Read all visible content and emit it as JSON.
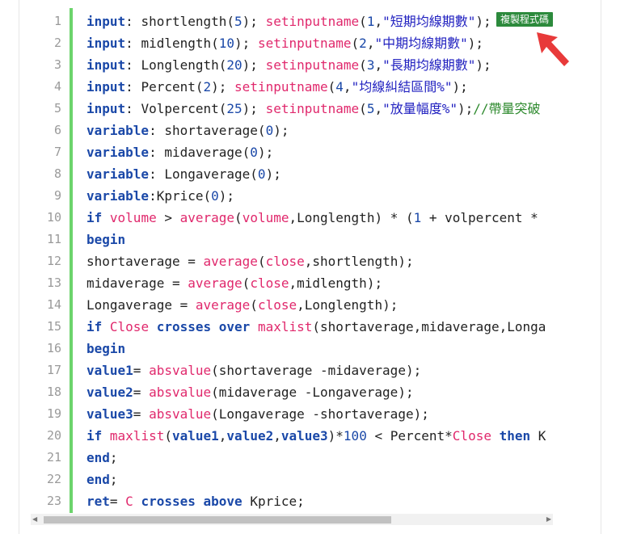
{
  "copy_button_label": "複製程式碼",
  "colors": {
    "keyword": "#1a48a8",
    "function": "#e0286c",
    "string": "#2121c0",
    "comment": "#2e8a2e",
    "accent_bar": "#6cd46c",
    "copy_button_bg": "#2c8a3c",
    "arrow": "#e83a3a"
  },
  "icons": {
    "arrow": "red-pointer-arrow-icon",
    "scroll_left": "scroll-left-arrow-icon",
    "scroll_right": "scroll-right-arrow-icon"
  },
  "line_numbers": [
    "1",
    "2",
    "3",
    "4",
    "5",
    "6",
    "7",
    "8",
    "9",
    "10",
    "11",
    "12",
    "13",
    "14",
    "15",
    "16",
    "17",
    "18",
    "19",
    "20",
    "21",
    "22",
    "23"
  ],
  "code": [
    [
      {
        "t": "input",
        "c": "kw"
      },
      {
        "t": ": shortlength(",
        "c": "plain"
      },
      {
        "t": "5",
        "c": "num"
      },
      {
        "t": "); ",
        "c": "plain"
      },
      {
        "t": "setinputname",
        "c": "fn"
      },
      {
        "t": "(",
        "c": "plain"
      },
      {
        "t": "1",
        "c": "num"
      },
      {
        "t": ",",
        "c": "plain"
      },
      {
        "t": "\"短期均線期數\"",
        "c": "str"
      },
      {
        "t": ");",
        "c": "plain"
      }
    ],
    [
      {
        "t": "input",
        "c": "kw"
      },
      {
        "t": ": midlength(",
        "c": "plain"
      },
      {
        "t": "10",
        "c": "num"
      },
      {
        "t": "); ",
        "c": "plain"
      },
      {
        "t": "setinputname",
        "c": "fn"
      },
      {
        "t": "(",
        "c": "plain"
      },
      {
        "t": "2",
        "c": "num"
      },
      {
        "t": ",",
        "c": "plain"
      },
      {
        "t": "\"中期均線期數\"",
        "c": "str"
      },
      {
        "t": ");",
        "c": "plain"
      }
    ],
    [
      {
        "t": "input",
        "c": "kw"
      },
      {
        "t": ": Longlength(",
        "c": "plain"
      },
      {
        "t": "20",
        "c": "num"
      },
      {
        "t": "); ",
        "c": "plain"
      },
      {
        "t": "setinputname",
        "c": "fn"
      },
      {
        "t": "(",
        "c": "plain"
      },
      {
        "t": "3",
        "c": "num"
      },
      {
        "t": ",",
        "c": "plain"
      },
      {
        "t": "\"長期均線期數\"",
        "c": "str"
      },
      {
        "t": ");",
        "c": "plain"
      }
    ],
    [
      {
        "t": "input",
        "c": "kw"
      },
      {
        "t": ": Percent(",
        "c": "plain"
      },
      {
        "t": "2",
        "c": "num"
      },
      {
        "t": "); ",
        "c": "plain"
      },
      {
        "t": "setinputname",
        "c": "fn"
      },
      {
        "t": "(",
        "c": "plain"
      },
      {
        "t": "4",
        "c": "num"
      },
      {
        "t": ",",
        "c": "plain"
      },
      {
        "t": "\"均線糾結區間%\"",
        "c": "str"
      },
      {
        "t": ");",
        "c": "plain"
      }
    ],
    [
      {
        "t": "input",
        "c": "kw"
      },
      {
        "t": ": Volpercent(",
        "c": "plain"
      },
      {
        "t": "25",
        "c": "num"
      },
      {
        "t": "); ",
        "c": "plain"
      },
      {
        "t": "setinputname",
        "c": "fn"
      },
      {
        "t": "(",
        "c": "plain"
      },
      {
        "t": "5",
        "c": "num"
      },
      {
        "t": ",",
        "c": "plain"
      },
      {
        "t": "\"放量幅度%\"",
        "c": "str"
      },
      {
        "t": ");",
        "c": "plain"
      },
      {
        "t": "//帶量突破",
        "c": "cm"
      }
    ],
    [
      {
        "t": "variable",
        "c": "kw"
      },
      {
        "t": ": shortaverage(",
        "c": "plain"
      },
      {
        "t": "0",
        "c": "num"
      },
      {
        "t": ");",
        "c": "plain"
      }
    ],
    [
      {
        "t": "variable",
        "c": "kw"
      },
      {
        "t": ": midaverage(",
        "c": "plain"
      },
      {
        "t": "0",
        "c": "num"
      },
      {
        "t": ");",
        "c": "plain"
      }
    ],
    [
      {
        "t": "variable",
        "c": "kw"
      },
      {
        "t": ": Longaverage(",
        "c": "plain"
      },
      {
        "t": "0",
        "c": "num"
      },
      {
        "t": ");",
        "c": "plain"
      }
    ],
    [
      {
        "t": "variable",
        "c": "kw"
      },
      {
        "t": ":Kprice(",
        "c": "plain"
      },
      {
        "t": "0",
        "c": "num"
      },
      {
        "t": ");",
        "c": "plain"
      }
    ],
    [
      {
        "t": "if",
        "c": "kw"
      },
      {
        "t": " ",
        "c": "plain"
      },
      {
        "t": "volume",
        "c": "fn"
      },
      {
        "t": " > ",
        "c": "plain"
      },
      {
        "t": "average",
        "c": "fn"
      },
      {
        "t": "(",
        "c": "plain"
      },
      {
        "t": "volume",
        "c": "fn"
      },
      {
        "t": ",Longlength) * (",
        "c": "plain"
      },
      {
        "t": "1",
        "c": "num"
      },
      {
        "t": " + volpercent * ",
        "c": "plain"
      }
    ],
    [
      {
        "t": "begin",
        "c": "kw"
      }
    ],
    [
      {
        "t": "shortaverage = ",
        "c": "plain"
      },
      {
        "t": "average",
        "c": "fn"
      },
      {
        "t": "(",
        "c": "plain"
      },
      {
        "t": "close",
        "c": "fn"
      },
      {
        "t": ",shortlength);",
        "c": "plain"
      }
    ],
    [
      {
        "t": "midaverage = ",
        "c": "plain"
      },
      {
        "t": "average",
        "c": "fn"
      },
      {
        "t": "(",
        "c": "plain"
      },
      {
        "t": "close",
        "c": "fn"
      },
      {
        "t": ",midlength);",
        "c": "plain"
      }
    ],
    [
      {
        "t": "Longaverage = ",
        "c": "plain"
      },
      {
        "t": "average",
        "c": "fn"
      },
      {
        "t": "(",
        "c": "plain"
      },
      {
        "t": "close",
        "c": "fn"
      },
      {
        "t": ",Longlength);",
        "c": "plain"
      }
    ],
    [
      {
        "t": "if",
        "c": "kw"
      },
      {
        "t": " ",
        "c": "plain"
      },
      {
        "t": "Close",
        "c": "fn"
      },
      {
        "t": " ",
        "c": "plain"
      },
      {
        "t": "crosses over",
        "c": "kw"
      },
      {
        "t": " ",
        "c": "plain"
      },
      {
        "t": "maxlist",
        "c": "fn"
      },
      {
        "t": "(shortaverage,midaverage,Longa",
        "c": "plain"
      }
    ],
    [
      {
        "t": "begin",
        "c": "kw"
      }
    ],
    [
      {
        "t": "value1",
        "c": "kw"
      },
      {
        "t": "= ",
        "c": "plain"
      },
      {
        "t": "absvalue",
        "c": "fn"
      },
      {
        "t": "(shortaverage -midaverage);",
        "c": "plain"
      }
    ],
    [
      {
        "t": "value2",
        "c": "kw"
      },
      {
        "t": "= ",
        "c": "plain"
      },
      {
        "t": "absvalue",
        "c": "fn"
      },
      {
        "t": "(midaverage -Longaverage);",
        "c": "plain"
      }
    ],
    [
      {
        "t": "value3",
        "c": "kw"
      },
      {
        "t": "= ",
        "c": "plain"
      },
      {
        "t": "absvalue",
        "c": "fn"
      },
      {
        "t": "(Longaverage -shortaverage);",
        "c": "plain"
      }
    ],
    [
      {
        "t": "if",
        "c": "kw"
      },
      {
        "t": " ",
        "c": "plain"
      },
      {
        "t": "maxlist",
        "c": "fn"
      },
      {
        "t": "(",
        "c": "plain"
      },
      {
        "t": "value1",
        "c": "kw"
      },
      {
        "t": ",",
        "c": "plain"
      },
      {
        "t": "value2",
        "c": "kw"
      },
      {
        "t": ",",
        "c": "plain"
      },
      {
        "t": "value3",
        "c": "kw"
      },
      {
        "t": ")*",
        "c": "plain"
      },
      {
        "t": "100",
        "c": "num"
      },
      {
        "t": " < Percent*",
        "c": "plain"
      },
      {
        "t": "Close",
        "c": "fn"
      },
      {
        "t": " ",
        "c": "plain"
      },
      {
        "t": "then",
        "c": "kw"
      },
      {
        "t": " K",
        "c": "plain"
      }
    ],
    [
      {
        "t": "end",
        "c": "kw"
      },
      {
        "t": ";",
        "c": "plain"
      }
    ],
    [
      {
        "t": "end",
        "c": "kw"
      },
      {
        "t": ";",
        "c": "plain"
      }
    ],
    [
      {
        "t": "ret",
        "c": "kw"
      },
      {
        "t": "= ",
        "c": "plain"
      },
      {
        "t": "C",
        "c": "fn"
      },
      {
        "t": " ",
        "c": "plain"
      },
      {
        "t": "crosses above",
        "c": "kw"
      },
      {
        "t": " Kprice;",
        "c": "plain"
      }
    ]
  ]
}
